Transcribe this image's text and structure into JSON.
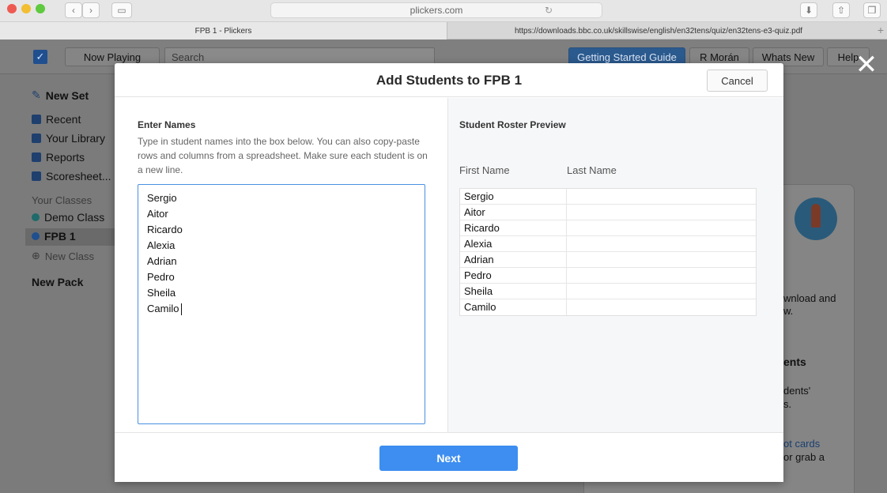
{
  "browser": {
    "url": "plickers.com",
    "tabs": [
      {
        "label": "FPB 1 - Plickers"
      },
      {
        "label": "https://downloads.bbc.co.uk/skillswise/english/en32tens/quiz/en32tens-e3-quiz.pdf"
      }
    ],
    "new_tab_glyph": "+"
  },
  "header": {
    "now_playing": "Now Playing",
    "search_placeholder": "Search",
    "getting_started": "Getting Started Guide",
    "user": "R Morán",
    "whats_new": "Whats New",
    "help": "Help"
  },
  "sidebar": {
    "new_set": "New Set",
    "recent": "Recent",
    "your_library": "Your Library",
    "reports": "Reports",
    "scoresheet": "Scoresheet...",
    "your_classes": "Your Classes",
    "demo_class": "Demo Class",
    "fpb1": "FPB 1",
    "new_class": "New Class",
    "new_pack": "New Pack"
  },
  "background": {
    "frag1": "wnload and",
    "frag2": "w.",
    "frag3": "ents",
    "frag4": "dents'",
    "frag5": "s.",
    "frag6": "ot cards",
    "frag7": "or grab a"
  },
  "modal": {
    "title": "Add Students to FPB 1",
    "cancel": "Cancel",
    "enter_names_title": "Enter Names",
    "enter_names_desc": "Type in student names into the box below. You can also copy-paste rows and columns from a spreadsheet. Make sure each student is on a new line.",
    "names": [
      "Sergio",
      "Aitor",
      "Ricardo",
      "Alexia",
      "Adrian",
      "Pedro",
      "Sheila",
      "Camilo"
    ],
    "roster_title": "Student Roster Preview",
    "col_first": "First Name",
    "col_last": "Last Name",
    "roster": [
      {
        "first": "Sergio",
        "last": ""
      },
      {
        "first": "Aitor",
        "last": ""
      },
      {
        "first": "Ricardo",
        "last": ""
      },
      {
        "first": "Alexia",
        "last": ""
      },
      {
        "first": "Adrian",
        "last": ""
      },
      {
        "first": "Pedro",
        "last": ""
      },
      {
        "first": "Sheila",
        "last": ""
      },
      {
        "first": "Camilo",
        "last": ""
      }
    ],
    "next": "Next"
  },
  "colors": {
    "accent": "#3d8ef0",
    "focus_border": "#4a90e2",
    "demo_dot": "#1f6a6a",
    "fpb_dot": "#1f4f8f"
  }
}
